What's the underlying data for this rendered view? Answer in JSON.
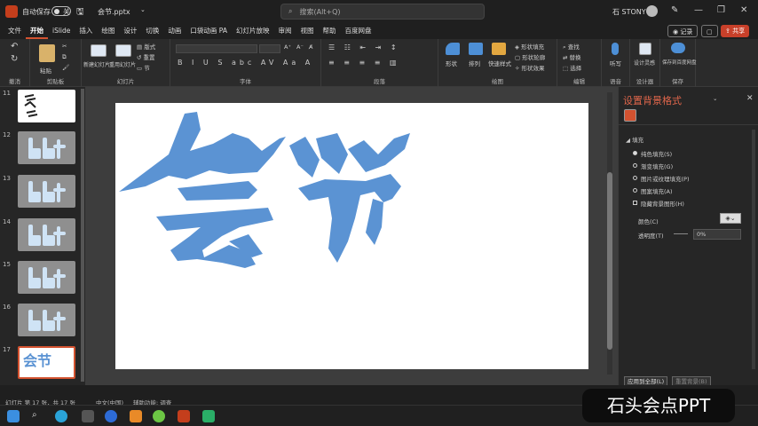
{
  "titlebar": {
    "autosave_label": "自动保存",
    "autosave_state": "关",
    "filename": "会节.pptx",
    "search_placeholder": "搜索(Alt+Q)",
    "user_name": "石 STONY",
    "window_buttons": [
      "—",
      "❐",
      "✕"
    ]
  },
  "menu": {
    "tabs": [
      "文件",
      "开始",
      "iSlide",
      "插入",
      "绘图",
      "设计",
      "切换",
      "动画",
      "口袋动画 PA",
      "幻灯片放映",
      "审阅",
      "视图",
      "帮助",
      "百度网盘"
    ],
    "active_tab": "开始",
    "record_label": "记录",
    "share_label": "共享",
    "share_color": "#c8402a"
  },
  "ribbon": {
    "undo_label": "撤消",
    "paste_label": "粘贴",
    "clipboard_label": "剪贴板",
    "new_slide_label": "新建幻灯片",
    "reuse_slide_label": "重用幻灯片",
    "layout_label": "版式",
    "reset_label": "重置",
    "section_label": "节",
    "slides_group_label": "幻灯片",
    "font_group_label": "字体",
    "paragraph_group_label": "段落",
    "shape_label": "形状",
    "arrange_label": "排列",
    "quick_styles_label": "快速样式",
    "fill_label": "形状填充",
    "outline_label": "形状轮廓",
    "effects_label": "形状效果",
    "drawing_group_label": "绘图",
    "find_label": "查找",
    "replace_label": "替换",
    "select_label": "选择",
    "editing_group_label": "编辑",
    "dictate_label": "听写",
    "voice_group_label": "语音",
    "designer_label": "设计灵感",
    "designer_group_label": "设计器",
    "save_baidu_label": "保存到百度网盘",
    "save_group_label": "保存"
  },
  "slides": [
    {
      "num": "11",
      "kind": "white"
    },
    {
      "num": "12",
      "kind": "bbt"
    },
    {
      "num": "13",
      "kind": "bbt"
    },
    {
      "num": "14",
      "kind": "bbt"
    },
    {
      "num": "15",
      "kind": "bbt"
    },
    {
      "num": "16",
      "kind": "bbt"
    },
    {
      "num": "17",
      "kind": "selected",
      "text": "会节"
    }
  ],
  "slide_main": {
    "text": "会节",
    "color": "#5b93d3"
  },
  "pane": {
    "title": "设置背景格式",
    "section": "填充",
    "options": [
      "纯色填充(S)",
      "渐变填充(G)",
      "图片或纹理填充(P)",
      "图案填充(A)",
      "隐藏背景图形(H)"
    ],
    "selected_option": 0,
    "color_label": "颜色(C)",
    "transparency_label": "透明度(T)",
    "transparency_value": "0%",
    "apply_all_label": "应用到全部(L)",
    "reset_label": "重置背景(B)"
  },
  "status": {
    "slide_info": "幻灯片 第 17 张，共 17 张",
    "language": "中文(中国)",
    "accessibility": "辅助功能: 调查"
  },
  "watermark": "石头会点PPT"
}
